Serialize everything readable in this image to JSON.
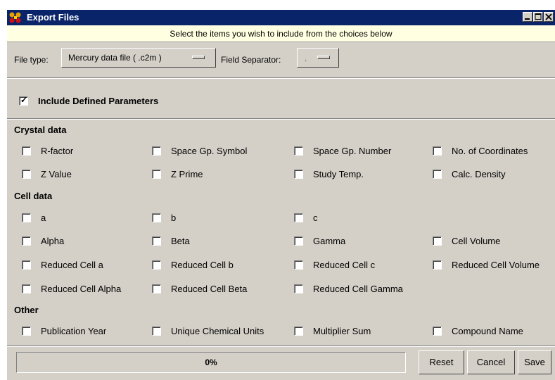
{
  "window": {
    "title": "Export Files"
  },
  "instructions": "Select the items you wish to include from the choices below",
  "toolbar": {
    "file_type_label": "File type:",
    "file_type_value": "Mercury data file ( .c2m )",
    "separator_label": "Field Separator:",
    "separator_value": ","
  },
  "include_defined": {
    "label": "Include Defined Parameters",
    "checked": true
  },
  "sections": {
    "crystal": "Crystal data",
    "cell": "Cell data",
    "other": "Other"
  },
  "options": {
    "r_factor": "R-factor",
    "space_gp_symbol": "Space Gp. Symbol",
    "space_gp_number": "Space Gp. Number",
    "no_coordinates": "No. of Coordinates",
    "z_value": "Z Value",
    "z_prime": "Z Prime",
    "study_temp": "Study Temp.",
    "calc_density": "Calc. Density",
    "a": "a",
    "b": "b",
    "c": "c",
    "alpha": "Alpha",
    "beta": "Beta",
    "gamma": "Gamma",
    "cell_volume": "Cell Volume",
    "red_a": "Reduced Cell a",
    "red_b": "Reduced Cell b",
    "red_c": "Reduced Cell c",
    "red_volume": "Reduced Cell Volume",
    "red_alpha": "Reduced Cell Alpha",
    "red_beta": "Reduced Cell Beta",
    "red_gamma": "Reduced Cell Gamma",
    "pub_year": "Publication Year",
    "unique_units": "Unique Chemical Units",
    "multiplier_sum": "Multiplier Sum",
    "compound_name": "Compound Name"
  },
  "progress": {
    "text": "0%",
    "value": 0
  },
  "buttons": {
    "reset": "Reset",
    "cancel": "Cancel",
    "save": "Save"
  }
}
